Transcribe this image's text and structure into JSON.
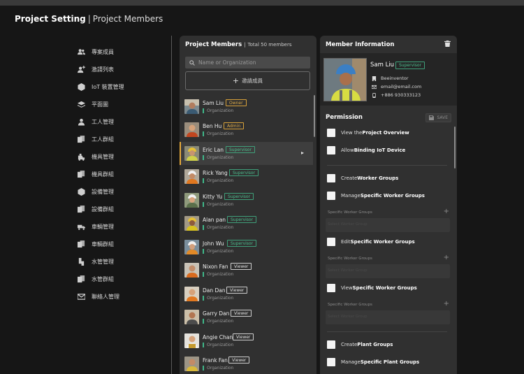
{
  "header": {
    "title": "Project Setting",
    "separator": "|",
    "subtitle": "Project Members"
  },
  "sidebar": {
    "items": [
      {
        "label": "專案成員",
        "icon": "people-icon"
      },
      {
        "label": "激請列表",
        "icon": "person-add-icon"
      },
      {
        "label": "IoT 裝置管理",
        "icon": "cube-icon"
      },
      {
        "label": "平面圖",
        "icon": "layers-icon"
      },
      {
        "label": "工人管理",
        "icon": "person-icon"
      },
      {
        "label": "工人群組",
        "icon": "copy-icon"
      },
      {
        "label": "機具管理",
        "icon": "machine-icon"
      },
      {
        "label": "機具群組",
        "icon": "copy-icon"
      },
      {
        "label": "設備管理",
        "icon": "cube-icon"
      },
      {
        "label": "設備群組",
        "icon": "copy-icon"
      },
      {
        "label": "車輛管理",
        "icon": "truck-icon"
      },
      {
        "label": "車輛群組",
        "icon": "copy-icon"
      },
      {
        "label": "水管管理",
        "icon": "pipe-icon"
      },
      {
        "label": "水管群組",
        "icon": "copy-icon"
      },
      {
        "label": "聯絡人管理",
        "icon": "mail-icon"
      }
    ]
  },
  "members": {
    "title": "Project Members",
    "separator": "|",
    "total": "Total 50 members",
    "search_placeholder": "Name or Organization",
    "invite_label": "邀請成員",
    "list": [
      {
        "name": "Sam Liu",
        "role": "Owner",
        "role_type": "owner",
        "org": "Organization"
      },
      {
        "name": "Ben Hu",
        "role": "Admin",
        "role_type": "admin",
        "org": "Organization"
      },
      {
        "name": "Eric Lan",
        "role": "Supervisor",
        "role_type": "supervisor",
        "org": "Organization",
        "selected": true
      },
      {
        "name": "Rick Yang",
        "role": "Supervisor",
        "role_type": "supervisor",
        "org": "Organization"
      },
      {
        "name": "Kitty Yu",
        "role": "Supervisor",
        "role_type": "supervisor",
        "org": "Organization"
      },
      {
        "name": "Alan pan",
        "role": "Supervisor",
        "role_type": "supervisor",
        "org": "Organization"
      },
      {
        "name": "John Wu",
        "role": "Supervisor",
        "role_type": "supervisor",
        "org": "Organization"
      },
      {
        "name": "Nixon Fan",
        "role": "Viewer",
        "role_type": "viewer",
        "org": "Organization"
      },
      {
        "name": "Dan Dan",
        "role": "Viewer",
        "role_type": "viewer",
        "org": "Organization"
      },
      {
        "name": "Garry Dan",
        "role": "Viewer",
        "role_type": "viewer",
        "org": "Organization"
      },
      {
        "name": "Angie Chan",
        "role": "Viewer",
        "role_type": "viewer",
        "org": "Organization"
      },
      {
        "name": "Frank Fan",
        "role": "Viewer",
        "role_type": "viewer",
        "org": "Organization"
      }
    ]
  },
  "info": {
    "title": "Member Information",
    "name": "Sam Liu",
    "role": "Supervisor",
    "company": "Beeinventor",
    "email": "email@email.com",
    "phone": "+886 930333123"
  },
  "permission": {
    "title": "Permission",
    "save_label": "SAVE",
    "group_placeholder": "Select Worker Group",
    "items": [
      {
        "pre": "View the ",
        "bold": "Project Overview"
      },
      {
        "pre": "Allow ",
        "bold": "Binding IoT Device"
      },
      {
        "pre": "Create ",
        "bold": "Worker Groups"
      },
      {
        "pre": "Manage ",
        "bold": "Specific Worker Groups"
      },
      {
        "pre": "Edit ",
        "bold": "Specific Worker Groups"
      },
      {
        "pre": "View ",
        "bold": "Specific Worker Groups"
      },
      {
        "pre": "Create ",
        "bold": "Plant Groups"
      },
      {
        "pre": "Manage ",
        "bold": "Specific Plant Groups"
      }
    ],
    "group_sections": [
      {
        "label": "Specific Worker Groups"
      },
      {
        "label": "Specific Worker Groups"
      },
      {
        "label": "Specific Worker Groups"
      }
    ]
  },
  "colors": {
    "background": "#161616",
    "panel": "#303030",
    "owner_admin": "#d9a23a",
    "supervisor": "#3fa07a",
    "org_marker": "#3fb88a"
  }
}
